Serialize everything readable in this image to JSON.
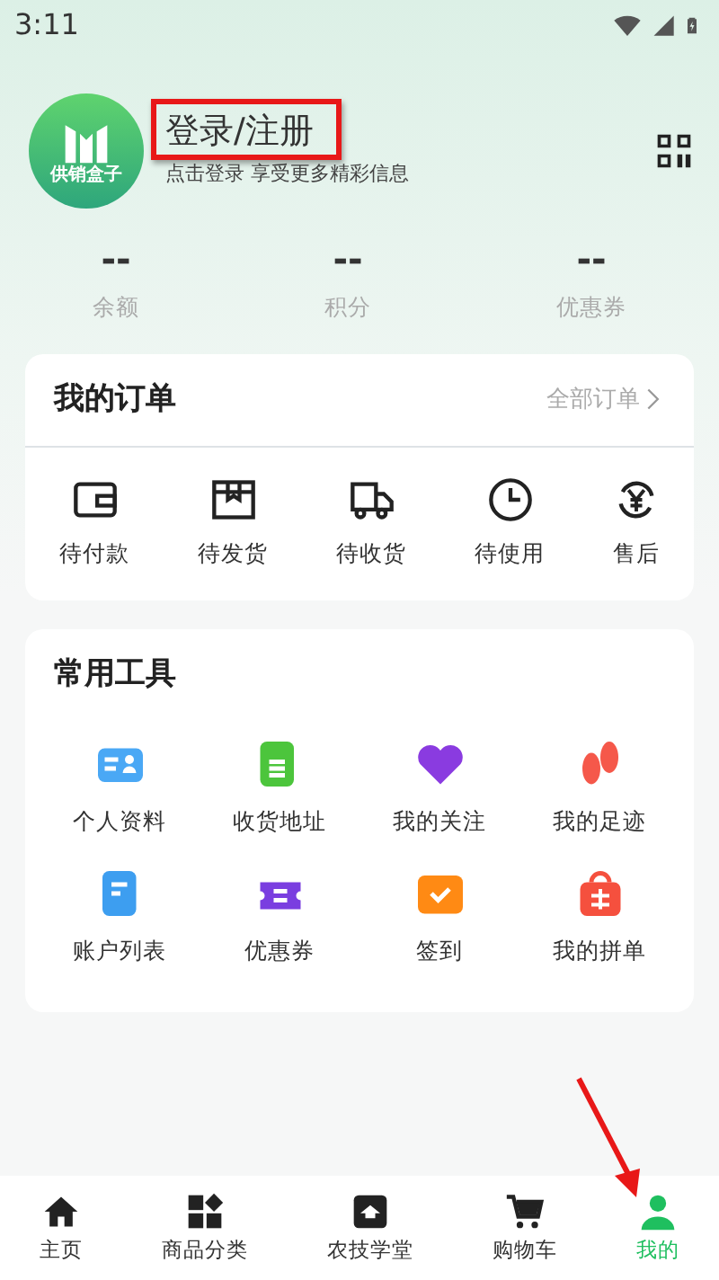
{
  "status_bar": {
    "time": "3:11"
  },
  "profile": {
    "logo_text": "供销盒子",
    "title": "登录/注册",
    "subtitle": "点击登录 享受更多精彩信息"
  },
  "stats": [
    {
      "value": "--",
      "label": "余额"
    },
    {
      "value": "--",
      "label": "积分"
    },
    {
      "value": "--",
      "label": "优惠券"
    }
  ],
  "orders": {
    "title": "我的订单",
    "link": "全部订单",
    "items": [
      {
        "kind": "wallet",
        "label": "待付款"
      },
      {
        "kind": "box",
        "label": "待发货"
      },
      {
        "kind": "truck",
        "label": "待收货"
      },
      {
        "kind": "clock",
        "label": "待使用"
      },
      {
        "kind": "refund",
        "label": "售后"
      }
    ]
  },
  "tools": {
    "title": "常用工具",
    "items": [
      {
        "kind": "card",
        "label": "个人资料",
        "color": "#4aa8f5"
      },
      {
        "kind": "doc",
        "label": "收货地址",
        "color": "#4cc53c"
      },
      {
        "kind": "heart",
        "label": "我的关注",
        "color": "#8a3be0"
      },
      {
        "kind": "feet",
        "label": "我的足迹",
        "color": "#f5584a"
      },
      {
        "kind": "file",
        "label": "账户列表",
        "color": "#3d9ef0"
      },
      {
        "kind": "ticket",
        "label": "优惠券",
        "color": "#7a3ee0"
      },
      {
        "kind": "calendar",
        "label": "签到",
        "color": "#ff8a14"
      },
      {
        "kind": "bag",
        "label": "我的拼单",
        "color": "#f5503e"
      }
    ]
  },
  "tab_bar": [
    {
      "kind": "home",
      "label": "主页",
      "selected": false
    },
    {
      "kind": "grid",
      "label": "商品分类",
      "selected": false
    },
    {
      "kind": "school",
      "label": "农技学堂",
      "selected": false
    },
    {
      "kind": "cart",
      "label": "购物车",
      "selected": false
    },
    {
      "kind": "person",
      "label": "我的",
      "selected": true
    }
  ],
  "annotations": {
    "highlight_frame": true,
    "pointer_arrow": true
  }
}
